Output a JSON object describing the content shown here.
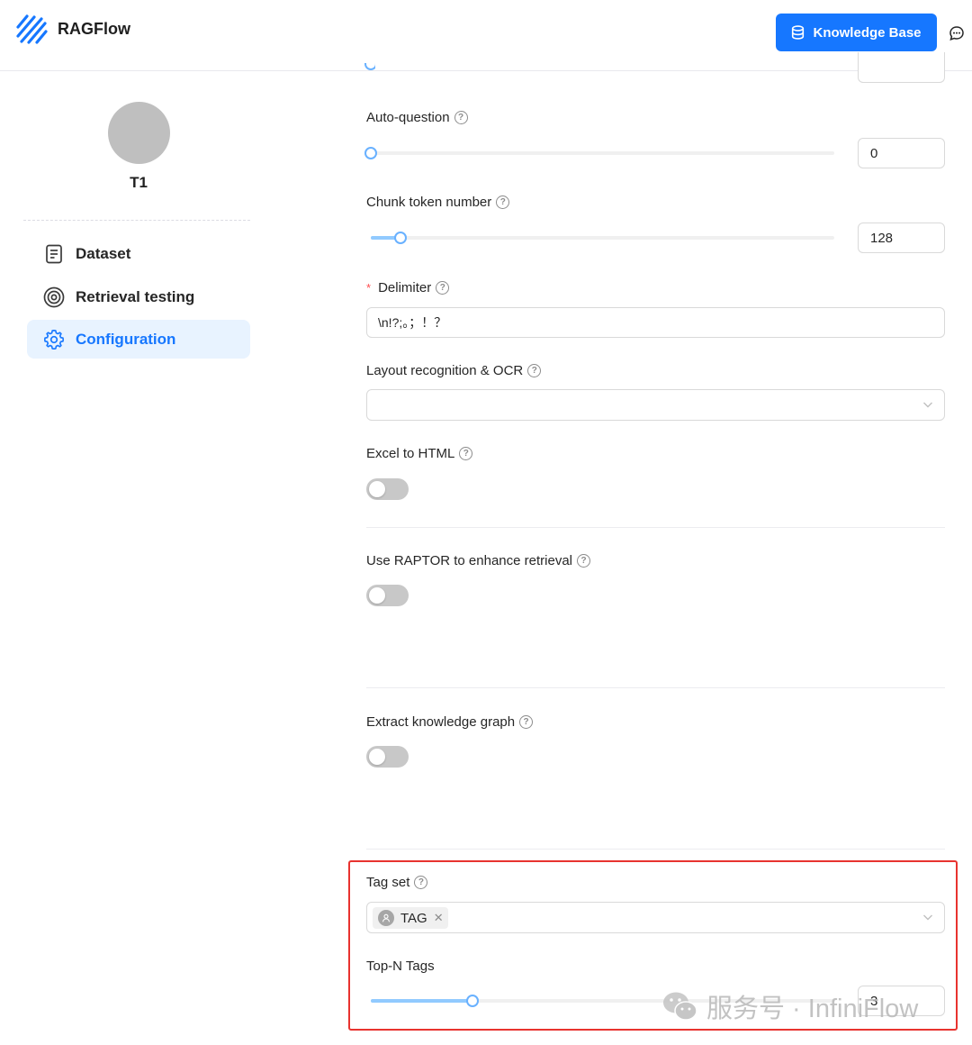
{
  "app": {
    "name": "RAGFlow"
  },
  "header": {
    "knowledge_base_label": "Knowledge Base"
  },
  "sidebar": {
    "kb_name": "T1",
    "items": [
      {
        "label": "Dataset",
        "icon": "document-icon"
      },
      {
        "label": "Retrieval testing",
        "icon": "target-icon"
      },
      {
        "label": "Configuration",
        "icon": "gear-icon",
        "active": true
      }
    ]
  },
  "form": {
    "auto_question": {
      "label": "Auto-question",
      "value": "0",
      "slider_fraction": 0.0
    },
    "chunk_token_number": {
      "label": "Chunk token number",
      "value": "128",
      "slider_fraction": 0.064
    },
    "delimiter": {
      "label": "Delimiter",
      "required_mark": "*",
      "value": "\\n!?;。；！？"
    },
    "layout_recognition": {
      "label": "Layout recognition & OCR",
      "value": ""
    },
    "excel_to_html": {
      "label": "Excel to HTML",
      "enabled": false
    },
    "use_raptor": {
      "label": "Use RAPTOR to enhance retrieval",
      "enabled": false
    },
    "extract_knowledge_graph": {
      "label": "Extract knowledge graph",
      "enabled": false
    },
    "tag_set": {
      "label": "Tag set",
      "selected": [
        "TAG"
      ]
    },
    "top_n_tags": {
      "label": "Top-N Tags",
      "value": "3",
      "slider_fraction": 0.22
    }
  },
  "watermark": {
    "text": "服务号 · InfiniFlow"
  },
  "colors": {
    "accent": "#1677ff",
    "highlight_border": "#e8332f",
    "slider_fill": "#91caff"
  }
}
